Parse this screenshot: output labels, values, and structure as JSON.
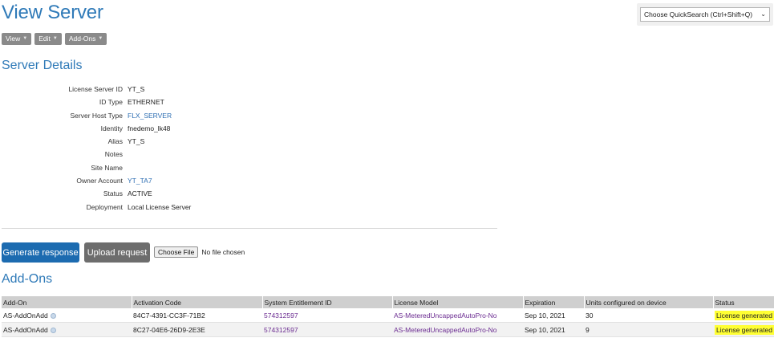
{
  "page": {
    "title": "View Server"
  },
  "quicksearch": {
    "label": "Choose QuickSearch (Ctrl+Shift+Q)"
  },
  "toolbar": {
    "view_label": "View",
    "edit_label": "Edit",
    "addons_label": "Add-Ons"
  },
  "server_details": {
    "title": "Server Details",
    "fields": [
      {
        "label": "License Server ID",
        "value": "YT_S"
      },
      {
        "label": "ID Type",
        "value": "ETHERNET"
      },
      {
        "label": "Server Host Type",
        "value": "FLX_SERVER"
      },
      {
        "label": "Identity",
        "value": "fnedemo_lk48"
      },
      {
        "label": "Alias",
        "value": "YT_S"
      },
      {
        "label": "Notes",
        "value": ""
      },
      {
        "label": "Site Name",
        "value": ""
      },
      {
        "label": "Owner Account",
        "value": "YT_TA7"
      },
      {
        "label": "Status",
        "value": "ACTIVE"
      },
      {
        "label": "Deployment",
        "value": "Local License Server"
      }
    ]
  },
  "actions": {
    "generate_response": "Generate response",
    "upload_request": "Upload request",
    "choose_file": "Choose File",
    "file_status": "No file chosen"
  },
  "addons": {
    "title": "Add-Ons",
    "columns": [
      "Add-On",
      "Activation Code",
      "System Entitlement ID",
      "License Model",
      "Expiration",
      "Units configured on device",
      "Status"
    ],
    "rows": [
      {
        "addon": "AS-AddOnAdd",
        "activation_code": "84C7-4391-CC3F-71B2",
        "entitlement_id": "574312597",
        "license_model": "AS-MeteredUncappedAutoPro-No",
        "expiration": "Sep 10, 2021",
        "units": "30",
        "status": "License generated"
      },
      {
        "addon": "AS-AddOnAdd",
        "activation_code": "8C27-04E6-26D9-2E3E",
        "entitlement_id": "574312597",
        "license_model": "AS-MeteredUncappedAutoPro-No",
        "expiration": "Sep 10, 2021",
        "units": "9",
        "status": "License generated"
      }
    ]
  },
  "colors": {
    "accent": "#2f7ab8",
    "primary_button": "#1c6bb0",
    "secondary_button": "#6d6d6d",
    "link_purple": "#6b2c91",
    "status_highlight": "#ffff33"
  }
}
